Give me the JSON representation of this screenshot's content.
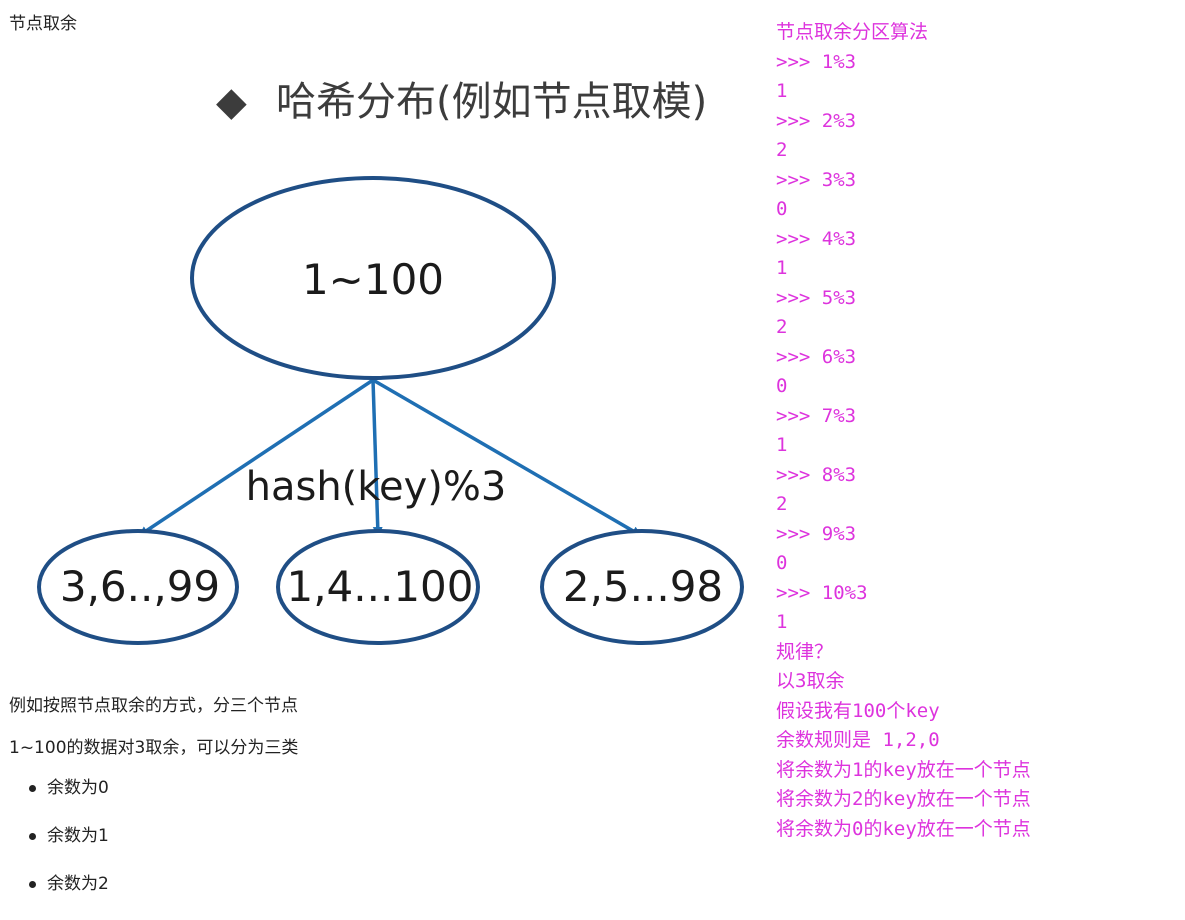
{
  "heading": "节点取余",
  "diagram": {
    "title_marker": "◆",
    "title": "哈希分布(例如节点取模)",
    "root": "1~100",
    "edge_label": "hash(key)%3",
    "children": [
      "3,6..,99",
      "1,4...100",
      "2,5...98"
    ],
    "colors": {
      "node_border": "#1f4e85",
      "arrow": "#1f6fb3"
    }
  },
  "paragraphs": [
    "例如按照节点取余的方式，分三个节点",
    "1~100的数据对3取余，可以分为三类"
  ],
  "bullets": [
    "余数为0",
    "余数为1",
    "余数为2"
  ],
  "code_lines": [
    "节点取余分区算法",
    ">>> 1%3",
    "1",
    ">>> 2%3",
    "2",
    ">>> 3%3",
    "0",
    ">>> 4%3",
    "1",
    ">>> 5%3",
    "2",
    ">>> 6%3",
    "0",
    ">>> 7%3",
    "1",
    ">>> 8%3",
    "2",
    ">>> 9%3",
    "0",
    ">>> 10%3",
    "1",
    "规律？",
    "以3取余",
    "假设我有100个key",
    "余数规则是 1,2,0",
    "将余数为1的key放在一个节点",
    "将余数为2的key放在一个节点",
    "将余数为0的key放在一个节点"
  ],
  "code_color": "#dd33dd"
}
